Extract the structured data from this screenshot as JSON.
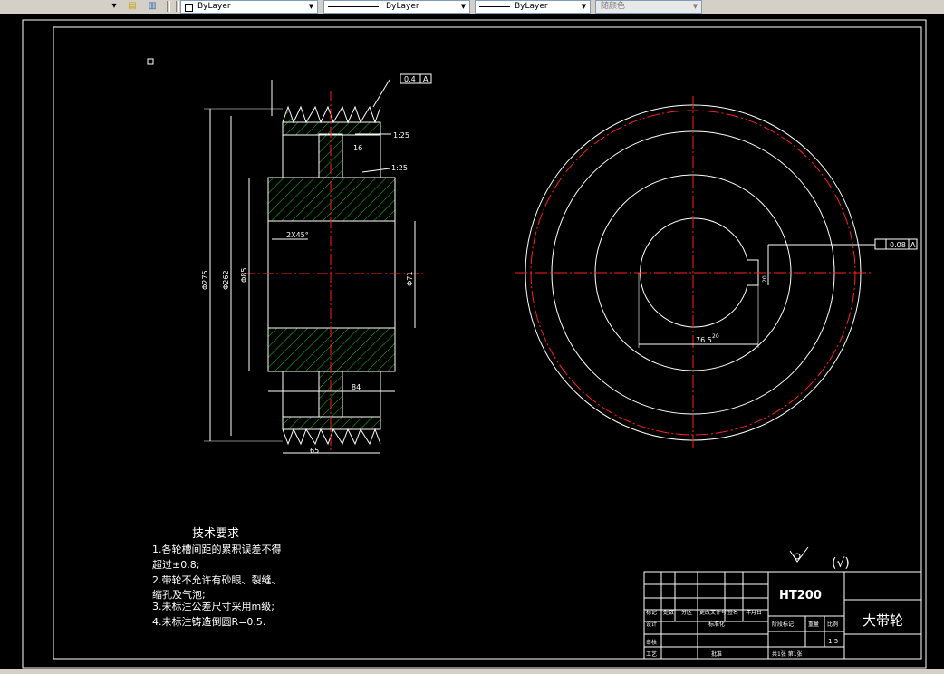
{
  "toolbar": {
    "layer_value": "ByLayer",
    "linetype_value": "ByLayer",
    "lineweight_value": "ByLayer",
    "plotstyle_value": "随颜色"
  },
  "drawing": {
    "tech_title": "技术要求",
    "tech_notes": [
      "1.各轮槽间距的累积误差不得",
      "超过±0.8;",
      "2.带轮不允许有砂眼、裂缝、",
      "缩孔及气泡;",
      "3.未标注公差尺寸采用m级;",
      "4.未标注铸造倒圆R=0.5."
    ],
    "material": "HT200",
    "part_name": "大带轮",
    "scale": "1:5",
    "roughness_note": "(√)",
    "tolerance_runout": "0.4",
    "tolerance_symmetry": "0.08",
    "datum": "A",
    "dims": {
      "top_width": "65",
      "hub_width": "84",
      "bore_width": "76.5",
      "keyway": "20",
      "d16": "16",
      "taper1": "1:25",
      "taper2": "1:25",
      "chamfer": "2X45°",
      "d_hub": "Φ71",
      "d_outer": "Φ275",
      "d_inner": "Φ262",
      "d_web": "Φ85"
    },
    "title_block": {
      "mark": "标记",
      "count": "处数",
      "zone": "分区",
      "doc_no": "更改文件号",
      "sign": "签名",
      "date": "年月日",
      "designer": "设计",
      "standardize": "标准化",
      "stage": "阶段标记",
      "weight": "重量",
      "ratio": "比例",
      "check": "审核",
      "process": "工艺",
      "approve": "批准",
      "sheets": "共1张 第1张"
    }
  }
}
